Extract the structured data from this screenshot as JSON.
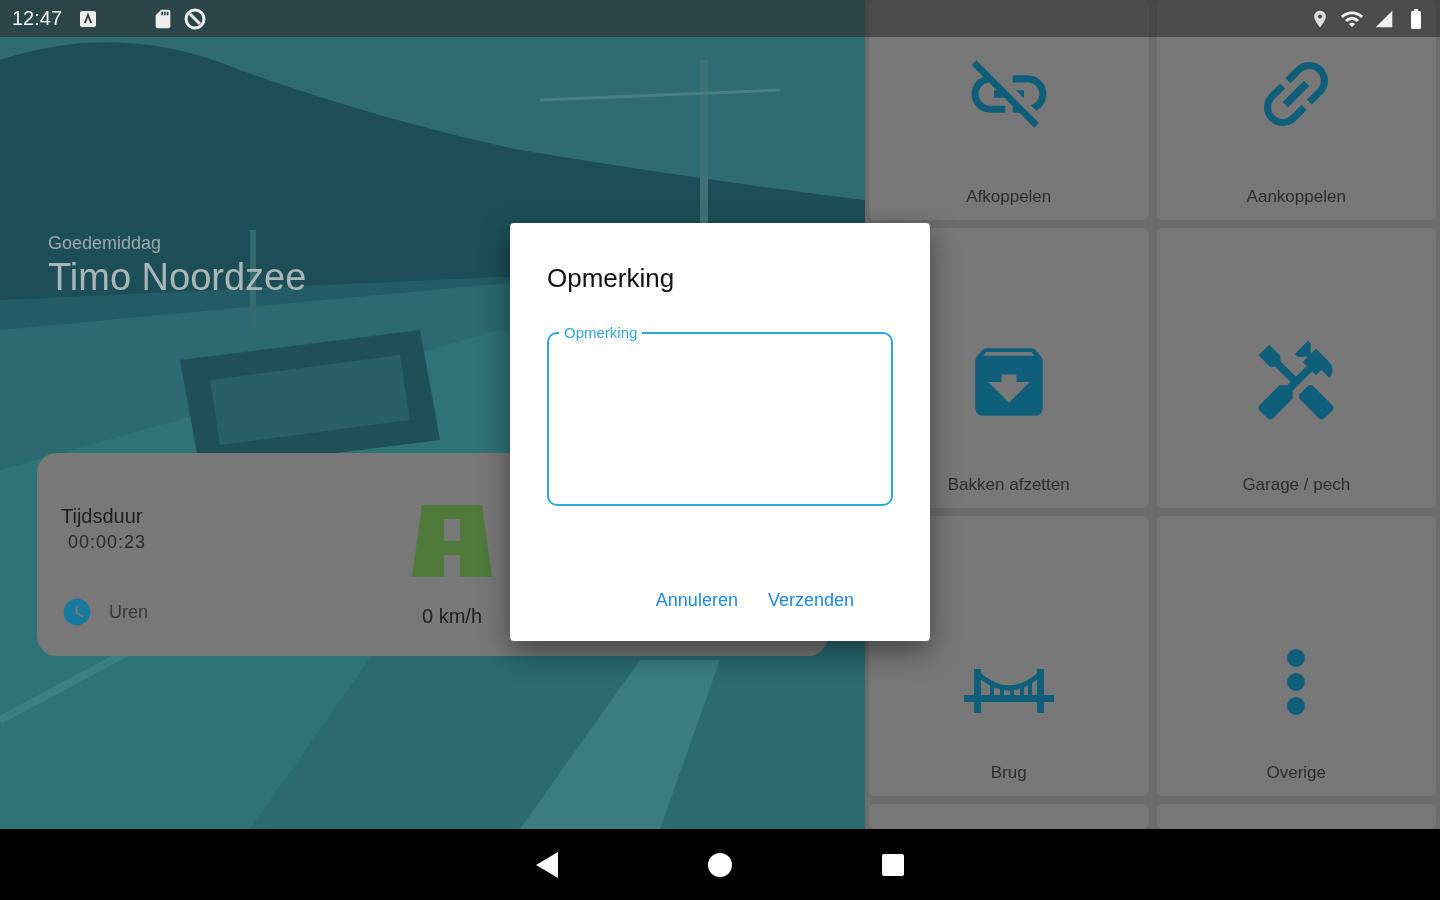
{
  "status_bar": {
    "time": "12:47"
  },
  "greeting": {
    "subtitle": "Goedemiddag",
    "name": "Timo Noordzee"
  },
  "trip_card": {
    "duration_label": "Tijdsduur",
    "duration": "00:00:23",
    "hours_label": "Uren",
    "speed": "0 km/h"
  },
  "actions": [
    {
      "label": "Afkoppelen",
      "kind": "unlink"
    },
    {
      "label": "Aankoppelen",
      "kind": "link"
    },
    {
      "label": "Bakken afzetten",
      "kind": "archive"
    },
    {
      "label": "Garage / pech",
      "kind": "tools"
    },
    {
      "label": "Brug",
      "kind": "bridge"
    },
    {
      "label": "Overige",
      "kind": "more"
    }
  ],
  "dialog": {
    "title": "Opmerking",
    "field": {
      "label": "Opmerking",
      "focused": true
    },
    "buttons": [
      "Annuleren",
      "Verzenden"
    ]
  }
}
